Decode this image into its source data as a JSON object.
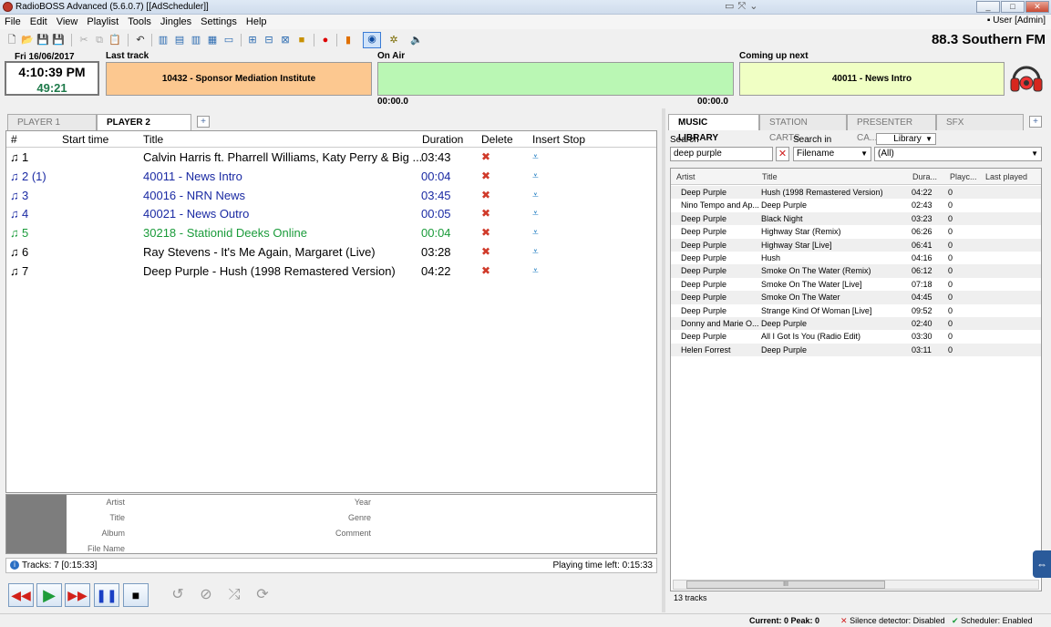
{
  "window": {
    "title": "RadioBOSS Advanced (5.6.0.7) [[AdScheduler]]",
    "user": "User [Admin]"
  },
  "menu": [
    "File",
    "Edit",
    "View",
    "Playlist",
    "Tools",
    "Jingles",
    "Settings",
    "Help"
  ],
  "station": "88.3 Southern FM",
  "clock": {
    "date": "Fri 16/06/2017",
    "time": "4:10:39 PM",
    "countdown": "49:21"
  },
  "panels": {
    "last_track_label": "Last track",
    "last_track": "10432 - Sponsor Mediation Institute",
    "on_air_label": "On Air",
    "on_air": "",
    "on_air_elapsed": "00:00.0",
    "on_air_remaining": "00:00.0",
    "next_label": "Coming up next",
    "next": "40011 - News Intro"
  },
  "colors": {
    "last_track_bg": "#fcc890",
    "on_air_bg": "#baf7b4",
    "next_bg": "#f0ffc4",
    "jingle_blue": "#1a2aa3",
    "jingle_green": "#1a9b3a"
  },
  "player_tabs": [
    "PLAYER 1",
    "PLAYER 2"
  ],
  "playlist": {
    "columns": {
      "num": "#",
      "start": "Start time",
      "title": "Title",
      "duration": "Duration",
      "delete": "Delete",
      "insert": "Insert Stop"
    },
    "rows": [
      {
        "num": "1",
        "title": "Calvin Harris ft. Pharrell Williams, Katy Perry & Big ...",
        "duration": "03:43",
        "kind": "music"
      },
      {
        "num": "2 (1)",
        "title": "40011 - News Intro",
        "duration": "00:04",
        "kind": "blue"
      },
      {
        "num": "3",
        "title": "40016 - NRN News",
        "duration": "03:45",
        "kind": "blue"
      },
      {
        "num": "4",
        "title": "40021 - News Outro",
        "duration": "00:05",
        "kind": "blue"
      },
      {
        "num": "5",
        "title": "30218 - Stationid Deeks Online",
        "duration": "00:04",
        "kind": "green"
      },
      {
        "num": "6",
        "title": "Ray Stevens - It's Me Again, Margaret (Live)",
        "duration": "03:28",
        "kind": "music"
      },
      {
        "num": "7",
        "title": "Deep Purple - Hush (1998 Remastered Version)",
        "duration": "04:22",
        "kind": "music"
      }
    ]
  },
  "info": {
    "artist": "Artist",
    "title": "Title",
    "album": "Album",
    "filename": "File Name",
    "year": "Year",
    "genre": "Genre",
    "comment": "Comment"
  },
  "status": {
    "tracks": "Tracks: 7 [0:15:33]",
    "time_left": "Playing time left: 0:15:33"
  },
  "library_tabs": [
    "MUSIC LIBRARY",
    "STATION CARTS",
    "PRESENTER CA...",
    "SFX"
  ],
  "library": {
    "search_label": "Search",
    "search_value": "deep purple",
    "search_in_label": "Search in",
    "library_select": "Library",
    "field_select": "Filename",
    "filter_select": "(All)",
    "columns": {
      "artist": "Artist",
      "title": "Title",
      "duration": "Dura...",
      "playcount": "Playc...",
      "last": "Last played"
    },
    "rows": [
      {
        "artist": "Deep Purple",
        "title": "Hush (1998 Remastered Version)",
        "duration": "04:22",
        "playcount": "0"
      },
      {
        "artist": "Nino Tempo and Ap...",
        "title": "Deep Purple",
        "duration": "02:43",
        "playcount": "0"
      },
      {
        "artist": "Deep Purple",
        "title": "Black Night",
        "duration": "03:23",
        "playcount": "0"
      },
      {
        "artist": "Deep Purple",
        "title": "Highway Star (Remix)",
        "duration": "06:26",
        "playcount": "0"
      },
      {
        "artist": "Deep Purple",
        "title": "Highway Star [Live]",
        "duration": "06:41",
        "playcount": "0"
      },
      {
        "artist": "Deep Purple",
        "title": "Hush",
        "duration": "04:16",
        "playcount": "0"
      },
      {
        "artist": "Deep Purple",
        "title": "Smoke On The Water (Remix)",
        "duration": "06:12",
        "playcount": "0"
      },
      {
        "artist": "Deep Purple",
        "title": "Smoke On The Water [Live]",
        "duration": "07:18",
        "playcount": "0"
      },
      {
        "artist": "Deep Purple",
        "title": "Smoke On The Water",
        "duration": "04:45",
        "playcount": "0"
      },
      {
        "artist": "Deep Purple",
        "title": "Strange Kind Of Woman [Live]",
        "duration": "09:52",
        "playcount": "0"
      },
      {
        "artist": "Donny and Marie O...",
        "title": "Deep Purple",
        "duration": "02:40",
        "playcount": "0"
      },
      {
        "artist": "Deep Purple",
        "title": "All I Got Is You (Radio Edit)",
        "duration": "03:30",
        "playcount": "0"
      },
      {
        "artist": "Helen Forrest",
        "title": "Deep Purple",
        "duration": "03:11",
        "playcount": "0"
      }
    ],
    "count": "13 tracks",
    "scroll_grip": "III"
  },
  "bottom": {
    "current": "Current: 0  Peak: 0",
    "silence": "Silence detector: Disabled",
    "scheduler": "Scheduler: Enabled"
  }
}
